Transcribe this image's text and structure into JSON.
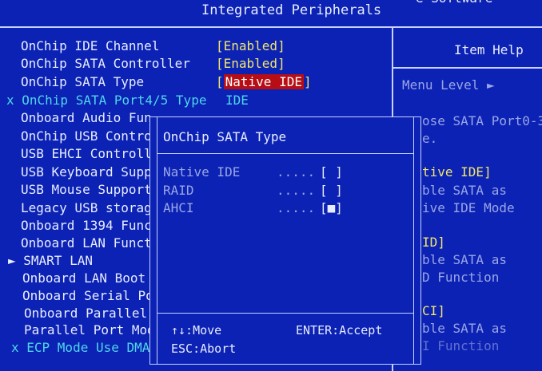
{
  "header": {
    "title": "Integrated Peripherals",
    "top_right_fragment": "e Software"
  },
  "menu_items": [
    {
      "label": "OnChip IDE Channel",
      "value": "[Enabled]"
    },
    {
      "label": "OnChip SATA Controller",
      "value": "[Enabled]"
    },
    {
      "label": "OnChip SATA Type",
      "value_prefix": "[",
      "value_highlight": "Native IDE",
      "value_suffix": "]"
    },
    {
      "label": "x OnChip SATA Port4/5 Type",
      "value": "IDE"
    },
    {
      "label": "Onboard Audio Fun"
    },
    {
      "label": "OnChip USB Contro"
    },
    {
      "label": "USB EHCI Controll"
    },
    {
      "label": "USB Keyboard Supp"
    },
    {
      "label": "USB Mouse Support"
    },
    {
      "label": "Legacy USB storag"
    },
    {
      "label": "Onboard 1394 Func"
    },
    {
      "label": "Onboard LAN Funct"
    },
    {
      "label": "► SMART LAN"
    },
    {
      "label": "Onboard LAN Boot"
    },
    {
      "label": "Onboard Serial Po"
    },
    {
      "label": "Onboard Parallel"
    },
    {
      "label": "Parallel Port Mod"
    },
    {
      "label": "x ECP Mode Use DMA"
    }
  ],
  "item_help": {
    "title": "Item Help",
    "menu_level": "Menu Level  ►",
    "lines": [
      "ose SATA Port0-3",
      "e.",
      "tive IDE]",
      "ble SATA as",
      "ive IDE Mode",
      "ID]",
      "ble SATA as",
      "D Function",
      "CI]",
      "ble SATA as",
      "I Function"
    ]
  },
  "popup": {
    "title": "OnChip SATA Type",
    "options": [
      {
        "label": "Native IDE",
        "dots": ".....",
        "box": "[ ]"
      },
      {
        "label": "RAID",
        "dots": ".....",
        "box": "[ ]"
      },
      {
        "label": "AHCI",
        "dots": ".....",
        "box": "[■]"
      }
    ],
    "hints": {
      "move": "↑↓:Move",
      "accept": "ENTER:Accept",
      "abort": "ESC:Abort"
    }
  },
  "colors": {
    "background": "#0b22b4",
    "label": "#e8ecff",
    "value": "#f2e56a",
    "disabled": "#4fd6ea",
    "highlight": "#b60e14"
  }
}
